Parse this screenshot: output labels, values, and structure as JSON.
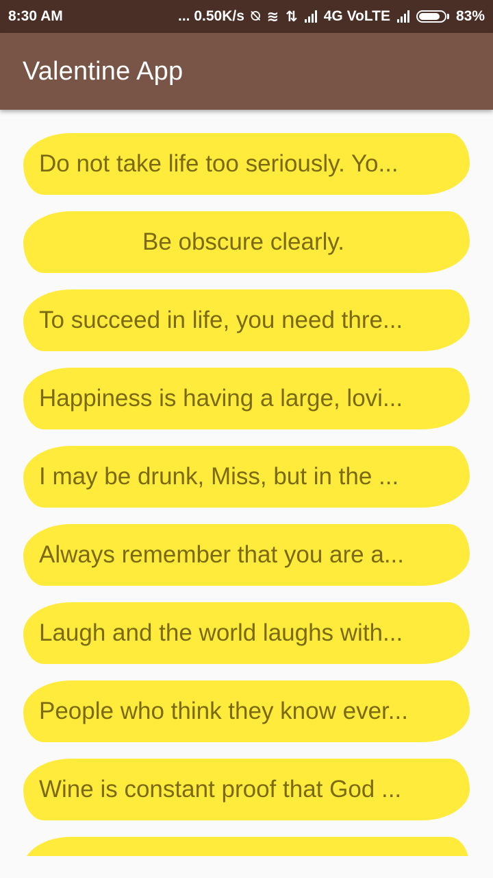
{
  "status_bar": {
    "time": "8:30 AM",
    "speed": "... 0.50K/s",
    "network": "4G VoLTE",
    "battery": "83%",
    "battery_level": 0.83
  },
  "app_bar": {
    "title": "Valentine App",
    "color": "#795548"
  },
  "quotes": [
    {
      "text": "Do not take life too seriously. Yo..."
    },
    {
      "text": "Be obscure clearly."
    },
    {
      "text": "To succeed in life, you need thre..."
    },
    {
      "text": "Happiness is having a large, lovi..."
    },
    {
      "text": "I may be drunk, Miss, but in the ..."
    },
    {
      "text": "Always remember that you are a..."
    },
    {
      "text": "Laugh and the world laughs with..."
    },
    {
      "text": "People who think they know ever..."
    },
    {
      "text": "Wine is constant proof that God ..."
    },
    {
      "text": ""
    }
  ],
  "colors": {
    "item_background": "#ffeb3b",
    "item_text": "#7a6a12",
    "status_bar": "#4a2f27"
  }
}
